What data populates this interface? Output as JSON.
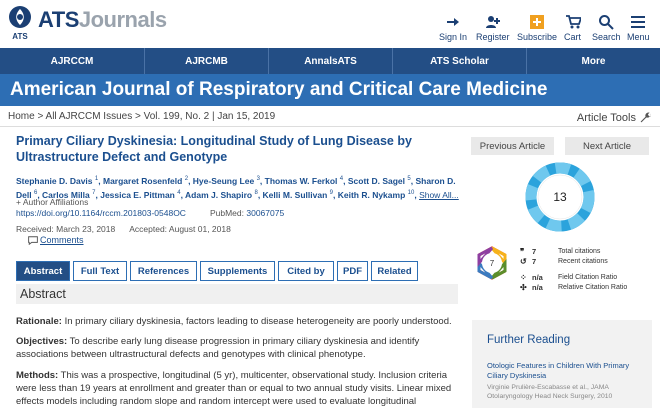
{
  "header": {
    "logo_main": "ATS",
    "logo_sub": "Journals",
    "logo_badge": "ATS",
    "util": [
      {
        "label": "Sign In",
        "icon": "sign-in-icon"
      },
      {
        "label": "Register",
        "icon": "register-icon"
      },
      {
        "label": "Subscribe",
        "icon": "subscribe-icon"
      },
      {
        "label": "Cart",
        "icon": "cart-icon"
      },
      {
        "label": "Search",
        "icon": "search-icon"
      },
      {
        "label": "Menu",
        "icon": "menu-icon"
      }
    ]
  },
  "nav": [
    "AJRCCM",
    "AJRCMB",
    "AnnalsATS",
    "ATS Scholar",
    "More"
  ],
  "banner": {
    "title": "American Journal of Respiratory and Critical Care Medicine"
  },
  "breadcrumb": {
    "text": "Home > All AJRCCM Issues > Vol. 199, No. 2 | Jan 15, 2019"
  },
  "article_tools": "Article Tools",
  "article": {
    "title": "Primary Ciliary Dyskinesia: Longitudinal Study of Lung Disease by Ultrastructure Defect and Genotype",
    "authors": [
      {
        "name": "Stephanie D. Davis",
        "sup": "1"
      },
      {
        "name": "Margaret Rosenfeld",
        "sup": "2"
      },
      {
        "name": "Hye-Seung Lee",
        "sup": "3"
      },
      {
        "name": "Thomas W. Ferkol",
        "sup": "4"
      },
      {
        "name": "Scott D. Sagel",
        "sup": "5"
      },
      {
        "name": "Sharon D. Dell",
        "sup": "6"
      },
      {
        "name": "Carlos Milla",
        "sup": "7"
      },
      {
        "name": "Jessica E. Pittman",
        "sup": "4"
      },
      {
        "name": "Adam J. Shapiro",
        "sup": "8"
      },
      {
        "name": "Kelli M. Sullivan",
        "sup": "9"
      },
      {
        "name": "Keith R. Nykamp",
        "sup": "10"
      }
    ],
    "show_all": "Show All...",
    "affiliations": "+ Author Affiliations",
    "doi": "https://doi.org/10.1164/rccm.201803-0548OC",
    "pubmed_label": "PubMed:",
    "pubmed_id": "30067075",
    "received": "Received: March 23, 2018",
    "accepted": "Accepted: August 01, 2018",
    "comments": "Comments"
  },
  "tabs": [
    "Abstract",
    "Full Text",
    "References",
    "Supplements",
    "Cited by",
    "PDF",
    "Related"
  ],
  "abstract": {
    "heading": "Abstract",
    "rationale_label": "Rationale:",
    "rationale": " In primary ciliary dyskinesia, factors leading to disease heterogeneity are poorly understood.",
    "objectives_label": "Objectives:",
    "objectives": " To describe early lung disease progression in primary ciliary dyskinesia and identify associations between ultrastructural defects and genotypes with clinical phenotype.",
    "methods_label": "Methods:",
    "methods": " This was a prospective, longitudinal (5 yr), multicenter, observational study. Inclusion criteria were less than 19 years at enrollment and greater than or equal to two annual study visits. Linear mixed effects models including random slope and random intercept were used to evaluate longitudinal"
  },
  "right": {
    "prev": "Previous Article",
    "next": "Next Article",
    "altmetric_score": "13",
    "dimensions_score": "7",
    "metrics": [
      {
        "icon": "quote-icon",
        "value": "7",
        "label": "Total citations"
      },
      {
        "icon": "recent-icon",
        "value": "7",
        "label": "Recent citations"
      },
      {
        "icon": "fcr-icon",
        "value": "n/a",
        "label": "Field Citation Ratio"
      },
      {
        "icon": "rcr-icon",
        "value": "n/a",
        "label": "Relative Citation Ratio"
      }
    ],
    "further_reading": {
      "title": "Further Reading",
      "item_title": "Otologic Features in Children With Primary Ciliary Dyskinesia",
      "item_source": "Virginie Prulière-Escabasse et al., JAMA Otolaryngology Head Neck Surgery, 2010"
    }
  }
}
